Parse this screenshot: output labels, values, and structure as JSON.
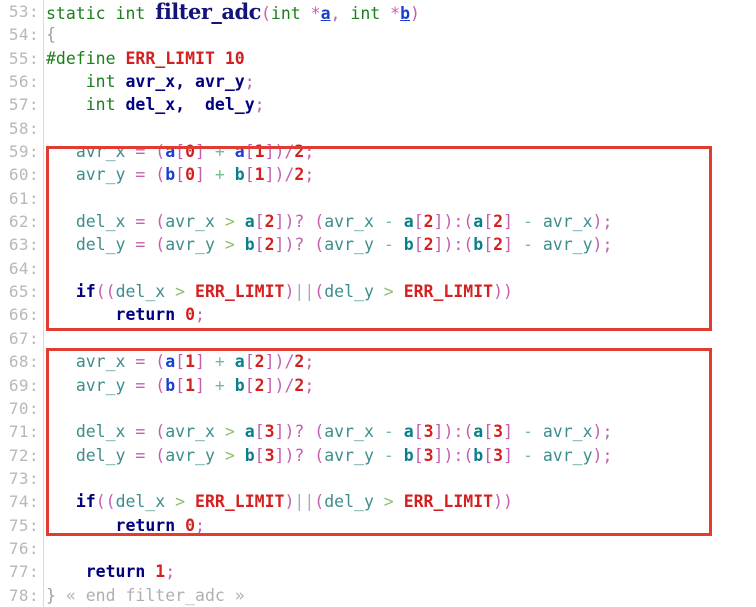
{
  "editor": {
    "language": "c",
    "first_line_number": 53,
    "last_line_number": 78,
    "gutter_separator": ":",
    "function_name": "filter_adc",
    "accent_highlight_color": "#e03c31",
    "line_number_color": "#b8b8b8"
  },
  "line_numbers": [
    "53:",
    "54:",
    "55:",
    "56:",
    "57:",
    "58:",
    "59:",
    "60:",
    "61:",
    "62:",
    "63:",
    "64:",
    "65:",
    "66:",
    "67:",
    "68:",
    "69:",
    "70:",
    "71:",
    "72:",
    "73:",
    "74:",
    "75:",
    "76:",
    "77:",
    "78:"
  ],
  "code": {
    "l53": {
      "kw_static_int": "static int ",
      "fname": "filter_adc",
      "open_paren": "(",
      "kw_int_1": "int ",
      "star_a": "*",
      "param_a": "a",
      "comma": ", ",
      "kw_int_2": "int ",
      "star_b": "*",
      "param_b": "b",
      "close_paren": ")"
    },
    "l54": {
      "brace_open": "{"
    },
    "l55": {
      "define": "#define ",
      "macro": "ERR_LIMIT ",
      "value": "10"
    },
    "l56": {
      "indent": "    ",
      "kw": "int ",
      "vars": "avr_x, avr_y",
      "semi": ";"
    },
    "l57": {
      "indent": "    ",
      "kw": "int ",
      "vars": "del_x,  del_y",
      "semi": ";"
    },
    "l58": {
      "blank": ""
    },
    "l59": {
      "indent": "   ",
      "lhs": "avr_x",
      "eq": " = ",
      "p1": "(",
      "arr1": "a",
      "b1o": "[",
      "i1": "0",
      "b1c": "]",
      "plus": " + ",
      "arr2": "a",
      "b2o": "[",
      "i2": "1",
      "b2c": "]",
      "p2": ")",
      "div": "/",
      "den": "2",
      "semi": ";"
    },
    "l60": {
      "indent": "   ",
      "lhs": "avr_y",
      "eq": " = ",
      "p1": "(",
      "arr1": "b",
      "b1o": "[",
      "i1": "0",
      "b1c": "]",
      "plus": " + ",
      "arr2": "b",
      "b2o": "[",
      "i2": "1",
      "b2c": "]",
      "p2": ")",
      "div": "/",
      "den": "2",
      "semi": ";"
    },
    "l61": {
      "blank": ""
    },
    "l62": {
      "indent": "   ",
      "lhs": "del_x",
      "eq": " = ",
      "p1": "(",
      "v1": "avr_x",
      "gt": " > ",
      "arr1": "a",
      "o1": "[",
      "i1": "2",
      "c1": "]",
      "q": ")? ",
      "p2": "(",
      "v2": "avr_x",
      "minus": " - ",
      "arr2": "a",
      "o2": "[",
      "i2": "2",
      "c2": "]",
      "p3": ")",
      "colon": ":",
      "p4": "(",
      "arr3": "a",
      "o3": "[",
      "i3": "2",
      "c3": "]",
      "minus2": " - ",
      "v3": "avr_x",
      "p5": ")",
      "semi": ";"
    },
    "l63": {
      "indent": "   ",
      "lhs": "del_y",
      "eq": " = ",
      "p1": "(",
      "v1": "avr_y",
      "gt": " > ",
      "arr1": "b",
      "o1": "[",
      "i1": "2",
      "c1": "]",
      "q": ")? ",
      "p2": "(",
      "v2": "avr_y",
      "minus": " - ",
      "arr2": "b",
      "o2": "[",
      "i2": "2",
      "c2": "]",
      "p3": ")",
      "colon": ":",
      "p4": "(",
      "arr3": "b",
      "o3": "[",
      "i3": "2",
      "c3": "]",
      "minus2": " - ",
      "v3": "avr_y",
      "p5": ")",
      "semi": ";"
    },
    "l64": {
      "blank": ""
    },
    "l65": {
      "indent": "   ",
      "kw": "if",
      "p1": "((",
      "v1": "del_x",
      "gt1": " > ",
      "m1": "ERR_LIMIT",
      "p2": ")",
      "or": "||",
      "p3": "(",
      "v2": "del_y",
      "gt2": " > ",
      "m2": "ERR_LIMIT",
      "p4": "))"
    },
    "l66": {
      "indent": "       ",
      "kw": "return ",
      "val": "0",
      "semi": ";"
    },
    "l67": {
      "blank": ""
    },
    "l68": {
      "indent": "   ",
      "lhs": "avr_x",
      "eq": " = ",
      "p1": "(",
      "arr1": "a",
      "b1o": "[",
      "i1": "1",
      "b1c": "]",
      "plus": " + ",
      "arr2": "a",
      "b2o": "[",
      "i2": "2",
      "b2c": "]",
      "p2": ")",
      "div": "/",
      "den": "2",
      "semi": ";"
    },
    "l69": {
      "indent": "   ",
      "lhs": "avr_y",
      "eq": " = ",
      "p1": "(",
      "arr1": "b",
      "b1o": "[",
      "i1": "1",
      "b1c": "]",
      "plus": " + ",
      "arr2": "b",
      "b2o": "[",
      "i2": "2",
      "b2c": "]",
      "p2": ")",
      "div": "/",
      "den": "2",
      "semi": ";"
    },
    "l70": {
      "blank": ""
    },
    "l71": {
      "indent": "   ",
      "lhs": "del_x",
      "eq": " = ",
      "p1": "(",
      "v1": "avr_x",
      "gt": " > ",
      "arr1": "a",
      "o1": "[",
      "i1": "3",
      "c1": "]",
      "q": ")? ",
      "p2": "(",
      "v2": "avr_x",
      "minus": " - ",
      "arr2": "a",
      "o2": "[",
      "i2": "3",
      "c2": "]",
      "p3": ")",
      "colon": ":",
      "p4": "(",
      "arr3": "a",
      "o3": "[",
      "i3": "3",
      "c3": "]",
      "minus2": " - ",
      "v3": "avr_x",
      "p5": ")",
      "semi": ";"
    },
    "l72": {
      "indent": "   ",
      "lhs": "del_y",
      "eq": " = ",
      "p1": "(",
      "v1": "avr_y",
      "gt": " > ",
      "arr1": "b",
      "o1": "[",
      "i1": "3",
      "c1": "]",
      "q": ")? ",
      "p2": "(",
      "v2": "avr_y",
      "minus": " - ",
      "arr2": "b",
      "o2": "[",
      "i2": "3",
      "c2": "]",
      "p3": ")",
      "colon": ":",
      "p4": "(",
      "arr3": "b",
      "o3": "[",
      "i3": "3",
      "c3": "]",
      "minus2": " - ",
      "v3": "avr_y",
      "p5": ")",
      "semi": ";"
    },
    "l73": {
      "blank": ""
    },
    "l74": {
      "indent": "   ",
      "kw": "if",
      "p1": "((",
      "v1": "del_x",
      "gt1": " > ",
      "m1": "ERR_LIMIT",
      "p2": ")",
      "or": "||",
      "p3": "(",
      "v2": "del_y",
      "gt2": " > ",
      "m2": "ERR_LIMIT",
      "p4": "))"
    },
    "l75": {
      "indent": "       ",
      "kw": "return ",
      "val": "0",
      "semi": ";"
    },
    "l76": {
      "blank": ""
    },
    "l77": {
      "indent": "    ",
      "kw": "return ",
      "val": "1",
      "semi": ";"
    },
    "l78": {
      "brace_close": "} ",
      "comment": "« end filter_adc »"
    }
  }
}
